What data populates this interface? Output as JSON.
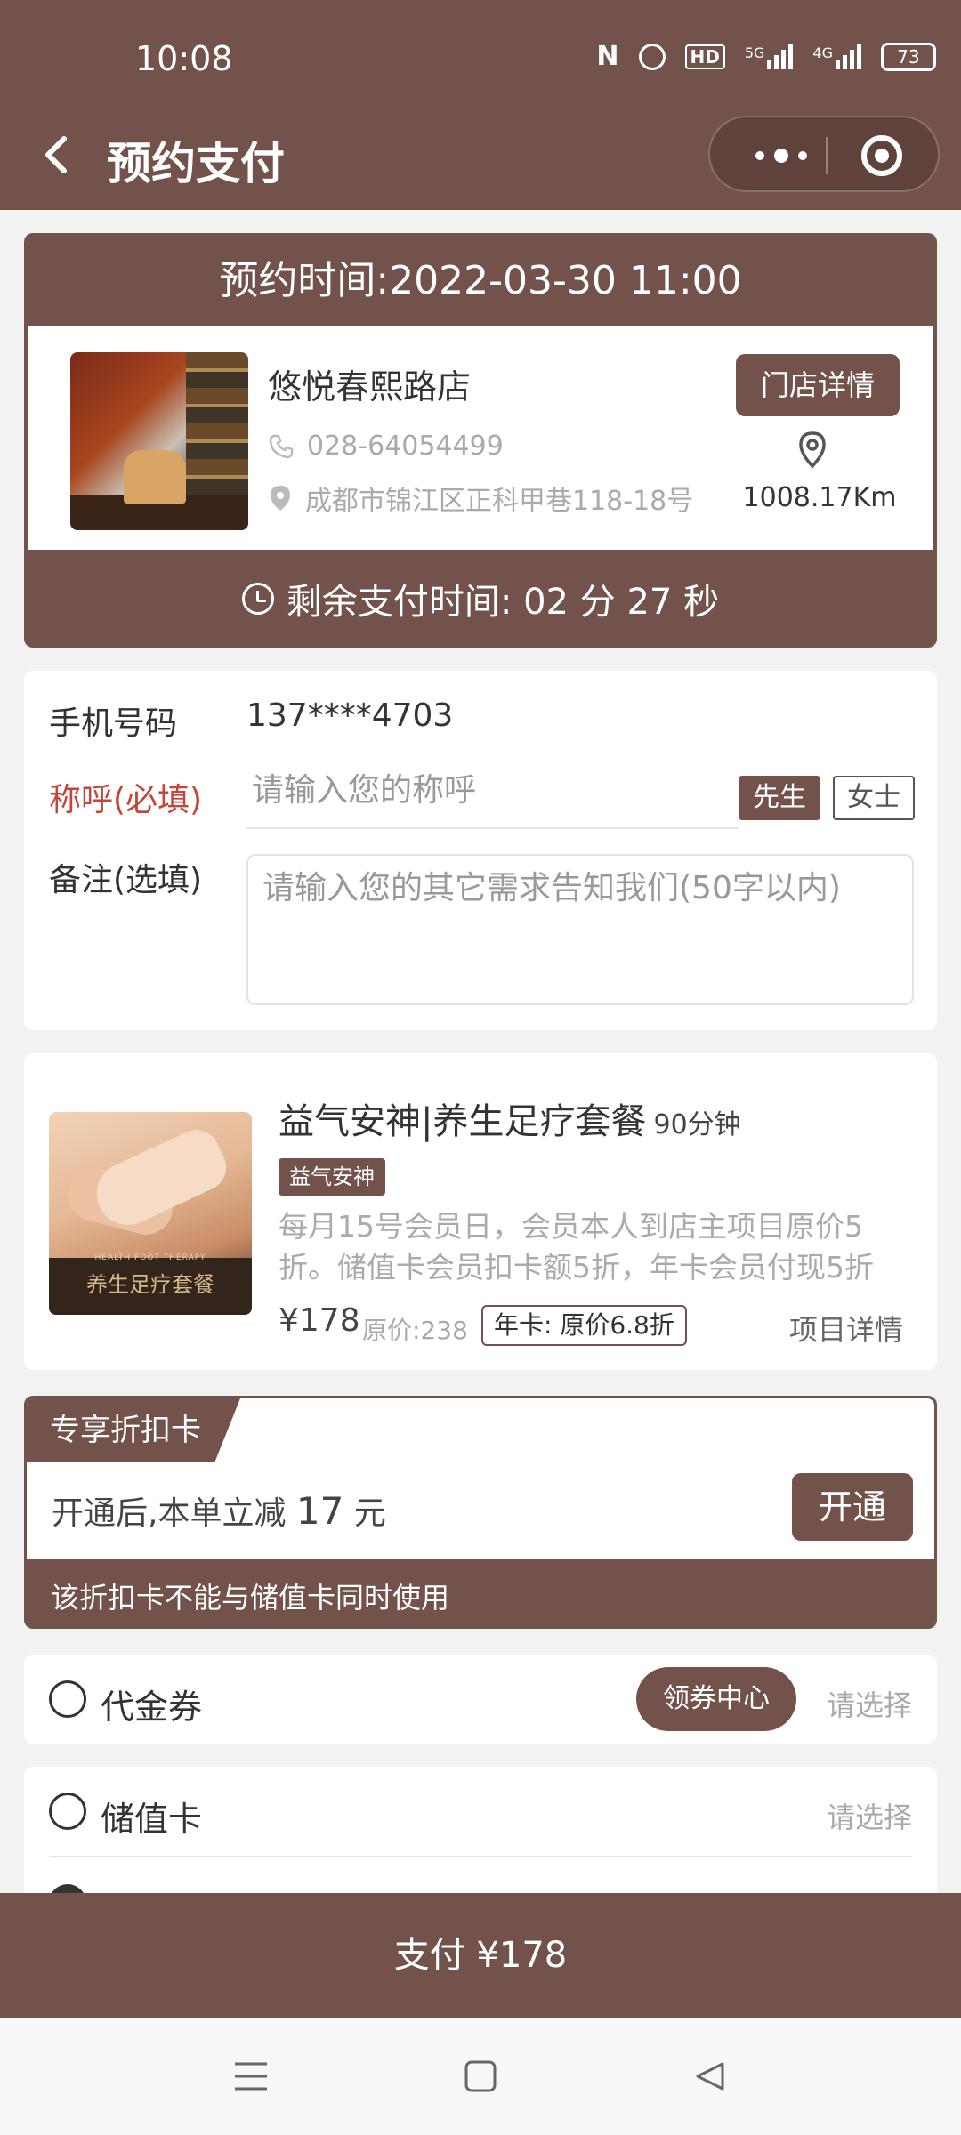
{
  "status_bar": {
    "time": "10:08",
    "network_1": "5G",
    "network_2": "4G",
    "hd_label": "HD",
    "battery": "73"
  },
  "nav": {
    "title": "预约支付"
  },
  "store": {
    "appointment_time": "预约时间:2022-03-30 11:00",
    "name": "悠悦春熙路店",
    "phone": "028-64054499",
    "address": "成都市锦江区正科甲巷118-18号",
    "detail_button": "门店详情",
    "distance": "1008.17Km",
    "remaining_label": "剩余支付时间: 02 分 27 秒"
  },
  "form": {
    "phone_label": "手机号码",
    "phone_value": "137****4703",
    "name_label": "称呼(必填)",
    "name_placeholder": "请输入您的称呼",
    "sex_male": "先生",
    "sex_female": "女士",
    "remark_label": "备注(选填)",
    "remark_placeholder": "请输入您的其它需求告知我们(50字以内)"
  },
  "product": {
    "title": "益气安神|养生足疗套餐",
    "duration": "90分钟",
    "tag": "益气安神",
    "image_caption": "养生足疗套餐",
    "image_subcaption": "HEALTH FOOT THERAPY",
    "description": "每月15号会员日，会员本人到店主项目原价5折。储值卡会员扣卡额5折，年卡会员付现5折",
    "price": "¥178",
    "original_price": "原价:238",
    "year_card": "年卡: 原价6.8折",
    "detail_link": "项目详情"
  },
  "discount": {
    "tab_label": "专享折扣卡",
    "text_prefix": "开通后,本单立减",
    "amount": "17",
    "unit": "元",
    "open_button": "开通",
    "note": "该折扣卡不能与储值卡同时使用"
  },
  "voucher": {
    "label": "代金券",
    "center_button": "领券中心",
    "pick": "请选择"
  },
  "stored_card": {
    "label": "储值卡",
    "pick": "请选择"
  },
  "pay": {
    "label": "支付 ¥178"
  },
  "colors": {
    "brand": "#72524a",
    "required": "#c4453a"
  }
}
